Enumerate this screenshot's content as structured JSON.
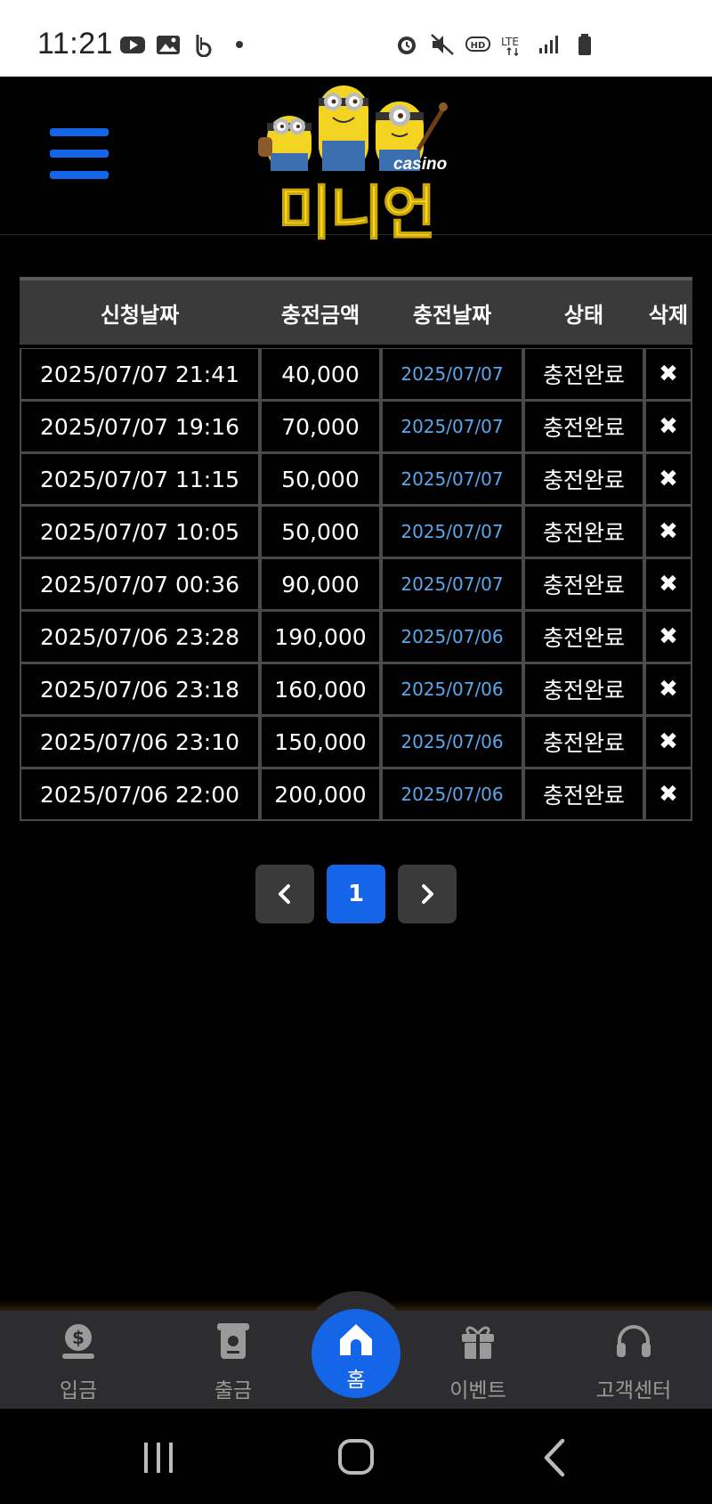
{
  "status_bar": {
    "time": "11:21",
    "left_icons": [
      "youtube-icon",
      "gallery-icon",
      "b-app-icon",
      "dot-icon"
    ],
    "right_icons": [
      "alarm-icon",
      "mute-icon",
      "hd-icon",
      "lte-icon",
      "signal-icon",
      "battery-icon"
    ]
  },
  "header": {
    "logo_small": "casino",
    "logo_main": "미니언",
    "menu_icon": "hamburger-icon"
  },
  "table": {
    "headers": [
      "신청날짜",
      "충전금액",
      "충전날짜",
      "상태",
      "삭제"
    ],
    "rows": [
      {
        "request_date": "2025/07/07 21:41",
        "amount": "40,000",
        "charge_date": "2025/07/07",
        "status": "충전완료",
        "delete": "✖"
      },
      {
        "request_date": "2025/07/07 19:16",
        "amount": "70,000",
        "charge_date": "2025/07/07",
        "status": "충전완료",
        "delete": "✖"
      },
      {
        "request_date": "2025/07/07 11:15",
        "amount": "50,000",
        "charge_date": "2025/07/07",
        "status": "충전완료",
        "delete": "✖"
      },
      {
        "request_date": "2025/07/07 10:05",
        "amount": "50,000",
        "charge_date": "2025/07/07",
        "status": "충전완료",
        "delete": "✖"
      },
      {
        "request_date": "2025/07/07 00:36",
        "amount": "90,000",
        "charge_date": "2025/07/07",
        "status": "충전완료",
        "delete": "✖"
      },
      {
        "request_date": "2025/07/06 23:28",
        "amount": "190,000",
        "charge_date": "2025/07/06",
        "status": "충전완료",
        "delete": "✖"
      },
      {
        "request_date": "2025/07/06 23:18",
        "amount": "160,000",
        "charge_date": "2025/07/06",
        "status": "충전완료",
        "delete": "✖"
      },
      {
        "request_date": "2025/07/06 23:10",
        "amount": "150,000",
        "charge_date": "2025/07/06",
        "status": "충전완료",
        "delete": "✖"
      },
      {
        "request_date": "2025/07/06 22:00",
        "amount": "200,000",
        "charge_date": "2025/07/06",
        "status": "충전완료",
        "delete": "✖"
      }
    ]
  },
  "pagination": {
    "current_page": "1",
    "prev_icon": "chevron-left-icon",
    "next_icon": "chevron-right-icon"
  },
  "bottom_nav": {
    "items": [
      {
        "label": "입금",
        "icon": "deposit-icon"
      },
      {
        "label": "출금",
        "icon": "withdraw-icon"
      },
      {
        "label": "홈",
        "icon": "home-icon"
      },
      {
        "label": "이벤트",
        "icon": "gift-icon"
      },
      {
        "label": "고객센터",
        "icon": "headset-icon"
      }
    ]
  },
  "system_nav": {
    "icons": [
      "recents-icon",
      "home-circle-icon",
      "back-icon"
    ]
  },
  "colors": {
    "accent": "#1565e9",
    "date_link": "#5aa7ec",
    "logo_yellow": "#f7d81c",
    "background": "#000000",
    "nav_bg": "#2d2d2f"
  }
}
